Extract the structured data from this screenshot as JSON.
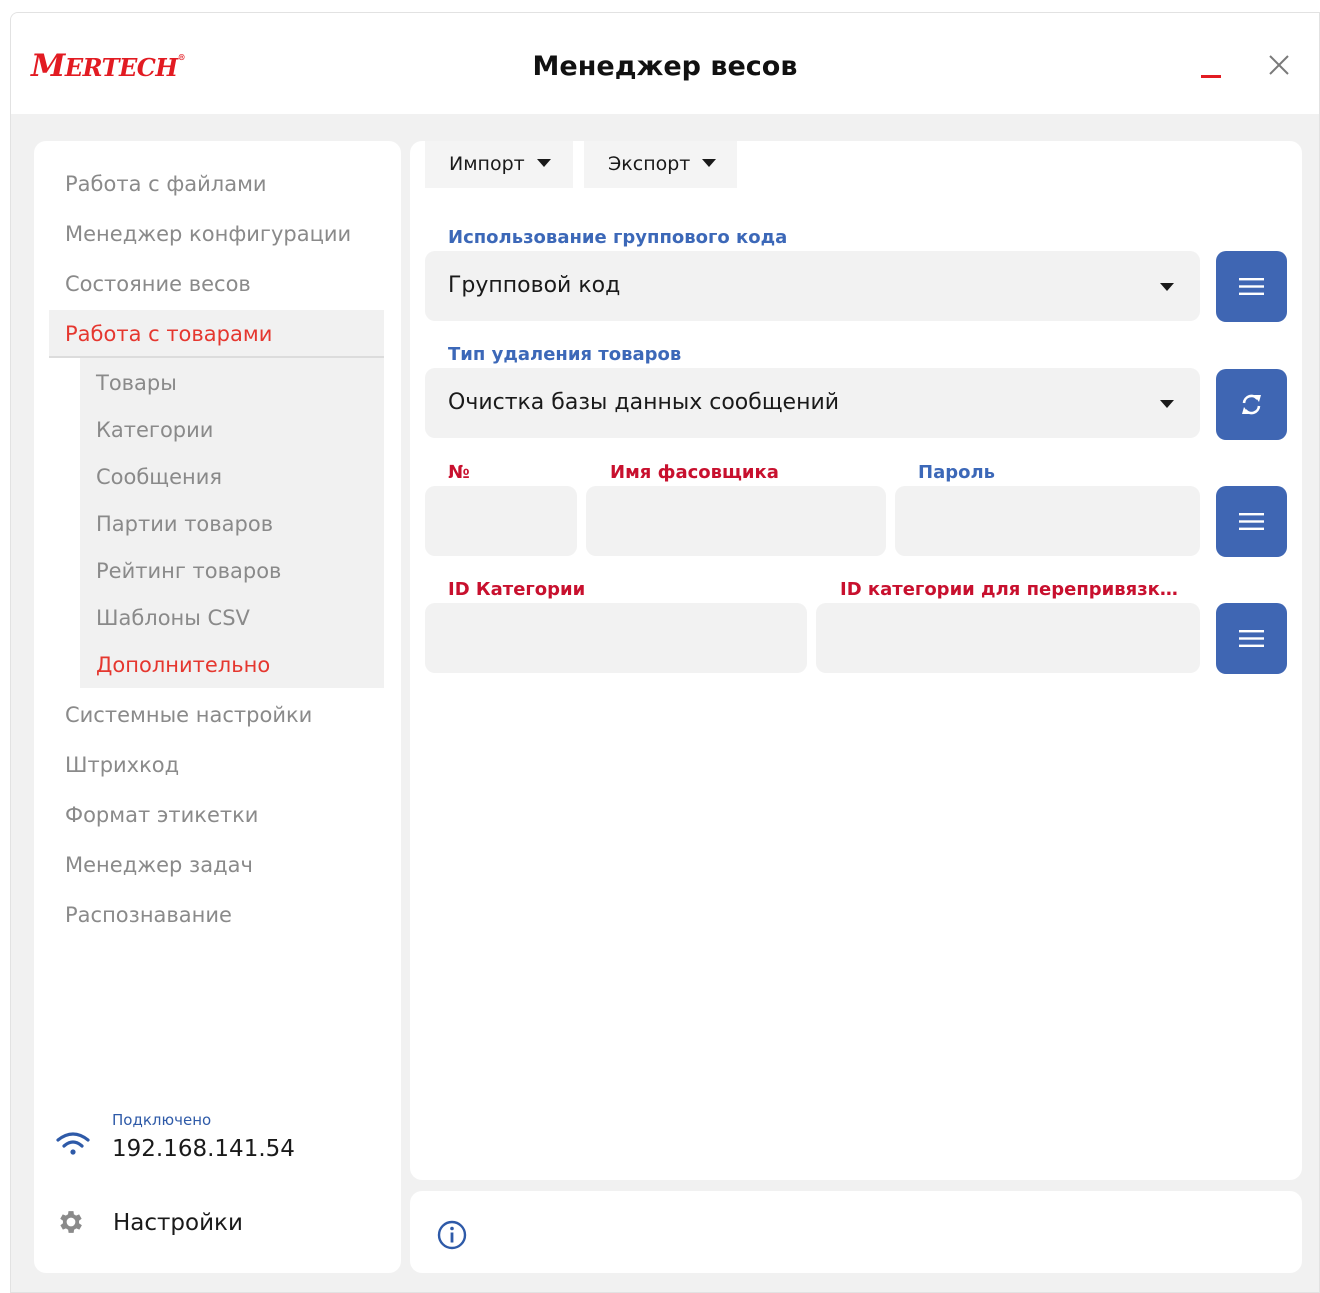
{
  "window": {
    "brand": "MERTECH",
    "title": "Менеджер весов",
    "minimize_icon": "minimize-icon",
    "close_icon": "close-icon",
    "accent_color": "#e21b22"
  },
  "sidebar": {
    "items": [
      {
        "label": "Работа с файлами"
      },
      {
        "label": "Менеджер конфигурации"
      },
      {
        "label": "Состояние весов"
      },
      {
        "label": "Работа с товарами",
        "active": true
      },
      {
        "label": "Системные настройки"
      },
      {
        "label": "Штрихкод"
      },
      {
        "label": "Формат этикетки"
      },
      {
        "label": "Менеджер задач"
      },
      {
        "label": "Распознавание"
      }
    ],
    "subitems": [
      {
        "label": "Товары"
      },
      {
        "label": "Категории"
      },
      {
        "label": "Сообщения"
      },
      {
        "label": "Партии товаров"
      },
      {
        "label": "Рейтинг товаров"
      },
      {
        "label": "Шаблоны CSV"
      },
      {
        "label": "Дополнительно",
        "active": true
      }
    ],
    "status": {
      "label": "Подключено",
      "ip": "192.168.141.54",
      "icon": "wifi-icon"
    },
    "settings": {
      "label": "Настройки",
      "icon": "gear-icon"
    }
  },
  "toolbar": {
    "import_label": "Импорт",
    "export_label": "Экспорт"
  },
  "form": {
    "group_code": {
      "label": "Использование группового кода",
      "value": "Групповой код",
      "button_icon": "menu-icon"
    },
    "delete_type": {
      "label": "Тип удаления товаров",
      "value": "Очистка базы данных сообщений",
      "button_icon": "refresh-icon"
    },
    "packer": {
      "number_label": "№",
      "name_label": "Имя фасовщика",
      "password_label": "Пароль",
      "number_value": "",
      "name_value": "",
      "password_value": "",
      "button_icon": "menu-icon"
    },
    "category": {
      "id_label": "ID Категории",
      "rebind_label": "ID категории для переприв­язк…",
      "id_value": "",
      "rebind_value": "",
      "button_icon": "menu-icon"
    }
  },
  "footer": {
    "info_icon": "info-icon"
  },
  "colors": {
    "primary_button": "#3f66b3",
    "label_blue": "#3c68b8",
    "label_red": "#c8102e",
    "active_nav": "#e5372f"
  }
}
